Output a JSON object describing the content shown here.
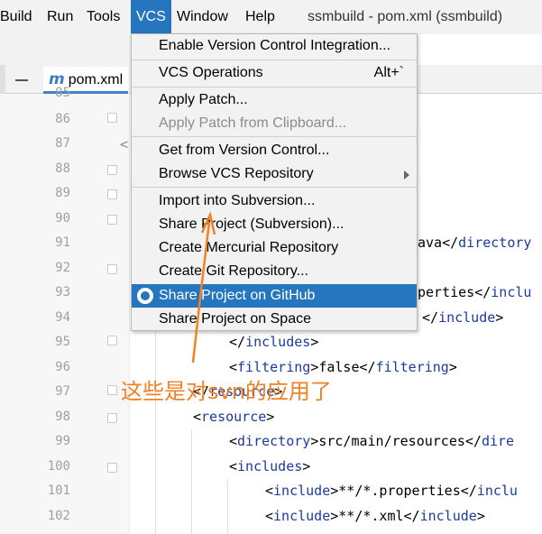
{
  "menubar": {
    "items": [
      "Build",
      "Run",
      "Tools",
      "VCS",
      "Window",
      "Help"
    ],
    "active": "VCS",
    "title": "ssmbuild - pom.xml (ssmbuild)"
  },
  "tab": {
    "icon_glyph": "m",
    "label": "pom.xml"
  },
  "editor": {
    "line_numbers": [
      "85",
      "86",
      "87",
      "88",
      "89",
      "90",
      "91",
      "92",
      "93",
      "94",
      "95",
      "96",
      "97",
      "98",
      "99",
      "100",
      "101",
      "102"
    ],
    "fragments": {
      "l87": "<",
      "l91a": "ava</",
      "l91b": "directory",
      "l93a": "perties</",
      "l93b": "inclu",
      "l94a": "</",
      "l94b": "include",
      "l94c": ">"
    },
    "lines": {
      "l95a": "</",
      "l95b": "includes",
      "l95c": ">",
      "l96a": "<",
      "l96b": "filtering",
      "l96c": ">false</",
      "l96d": "filtering",
      "l96e": ">",
      "l97a": "</",
      "l97b": "resource",
      "l97c": ">",
      "l98a": "<",
      "l98b": "resource",
      "l98c": ">",
      "l99a": "<",
      "l99b": "directory",
      "l99c": ">src/main/resources</",
      "l99d": "dire",
      "l100a": "<",
      "l100b": "includes",
      "l100c": ">",
      "l101a": "<",
      "l101b": "include",
      "l101c": ">**/*.properties</",
      "l101d": "inclu",
      "l102a": "<",
      "l102b": "include",
      "l102c": ">**/*.xml</",
      "l102d": "include",
      "l102e": ">"
    }
  },
  "dropdown": {
    "items": [
      {
        "label": "Enable Version Control Integration..."
      },
      {
        "label": "VCS Operations",
        "shortcut": "Alt+`"
      },
      {
        "label": "Apply Patch..."
      },
      {
        "label": "Apply Patch from Clipboard...",
        "disabled": true
      },
      {
        "label": "Get from Version Control..."
      },
      {
        "label": "Browse VCS Repository",
        "submenu": true
      },
      {
        "label": "Import into Subversion..."
      },
      {
        "label": "Share Project (Subversion)..."
      },
      {
        "label": "Create Mercurial Repository"
      },
      {
        "label": "Create Git Repository..."
      },
      {
        "label": "Share Project on GitHub",
        "selected": true,
        "icon": "github-icon"
      },
      {
        "label": "Share Project on Space"
      }
    ]
  },
  "annotation": {
    "text": "这些是对svn的应用了",
    "color": "#f18224"
  },
  "colors": {
    "accent": "#2675bf",
    "tag": "#1c3b9c"
  }
}
